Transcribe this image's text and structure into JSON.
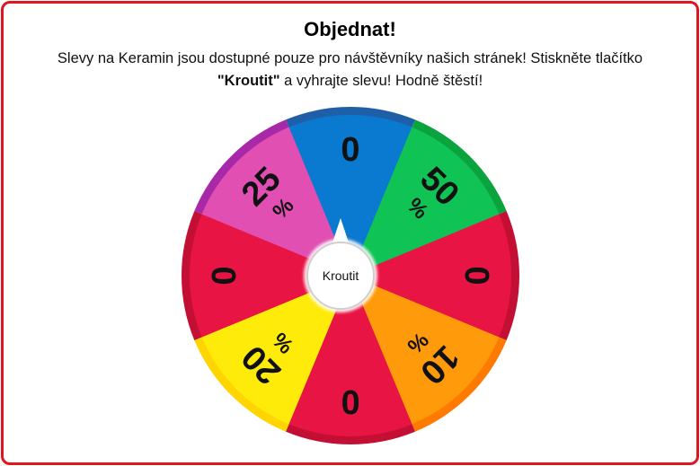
{
  "popup": {
    "title": "Objednat!",
    "desc_part1": "Slevy na Keramin jsou dostupné pouze pro návštěvníky našich stránek! Stiskněte tlačítko",
    "desc_bold": "\"Kroutit\"",
    "desc_part2": "a vyhrajte slevu! Hodně štěstí!"
  },
  "wheel": {
    "spin_label": "Kroutit",
    "segments": [
      {
        "label": "0",
        "color": "#0a7ad0",
        "rim": "#1f5fa8",
        "percent": false
      },
      {
        "label": "50",
        "color": "#0fc455",
        "rim": "#0aa33e",
        "percent": true
      },
      {
        "label": "0",
        "color": "#e81443",
        "rim": "#c40f35",
        "percent": false
      },
      {
        "label": "10",
        "color": "#ff9a0a",
        "rim": "#ff7a00",
        "percent": true
      },
      {
        "label": "0",
        "color": "#e81443",
        "rim": "#c40f35",
        "percent": false
      },
      {
        "label": "20",
        "color": "#ffeb0a",
        "rim": "#ffd500",
        "percent": true
      },
      {
        "label": "0",
        "color": "#e81443",
        "rim": "#c40f35",
        "percent": false
      },
      {
        "label": "25",
        "color": "#e14fb3",
        "rim": "#a829a8",
        "percent": true
      }
    ],
    "percent_sign": "%"
  },
  "colors": {
    "border": "#e0161e"
  }
}
